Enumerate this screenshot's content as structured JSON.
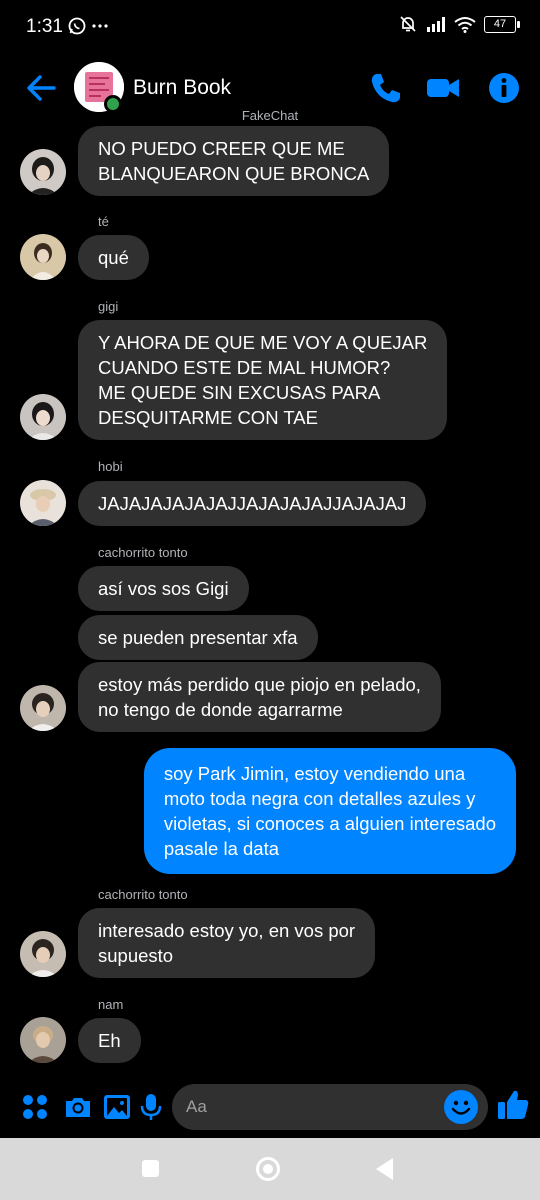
{
  "status_bar": {
    "time": "1:31",
    "battery": "47"
  },
  "header": {
    "title": "Burn Book",
    "subtitle": "FakeChat"
  },
  "messages": [
    {
      "sender": "",
      "text": "NO PUEDO CREER QUE ME\nBLANQUEARON QUE BRONCA"
    },
    {
      "sender": "té",
      "text": "qué"
    },
    {
      "sender": "gigi",
      "text": "Y AHORA DE QUE ME VOY A QUEJAR\nCUANDO ESTE DE MAL HUMOR?\nME QUEDE SIN EXCUSAS PARA\nDESQUITARME CON TAE"
    },
    {
      "sender": "hobi",
      "text": "JAJAJAJAJAJAJJAJAJAJAJJAJAJAJ"
    },
    {
      "sender": "cachorrito tonto",
      "text": "así vos sos Gigi"
    },
    {
      "sender": "",
      "text": "se pueden presentar xfa"
    },
    {
      "sender": "",
      "text": "estoy más perdido que piojo en pelado,\nno tengo de donde agarrarme"
    },
    {
      "sender": "me",
      "text": "soy Park Jimin, estoy vendiendo una\nmoto toda negra con detalles azules y\nvioletas, si conoces a alguien interesado\npasale la data"
    },
    {
      "sender": "cachorrito tonto",
      "text": "interesado estoy yo, en vos por\nsupuesto"
    },
    {
      "sender": "nam",
      "text": "Eh"
    }
  ],
  "composer": {
    "placeholder": "Aa"
  },
  "colors": {
    "accent": "#0084ff",
    "bubble_other": "#303030",
    "online": "#31a24c"
  }
}
